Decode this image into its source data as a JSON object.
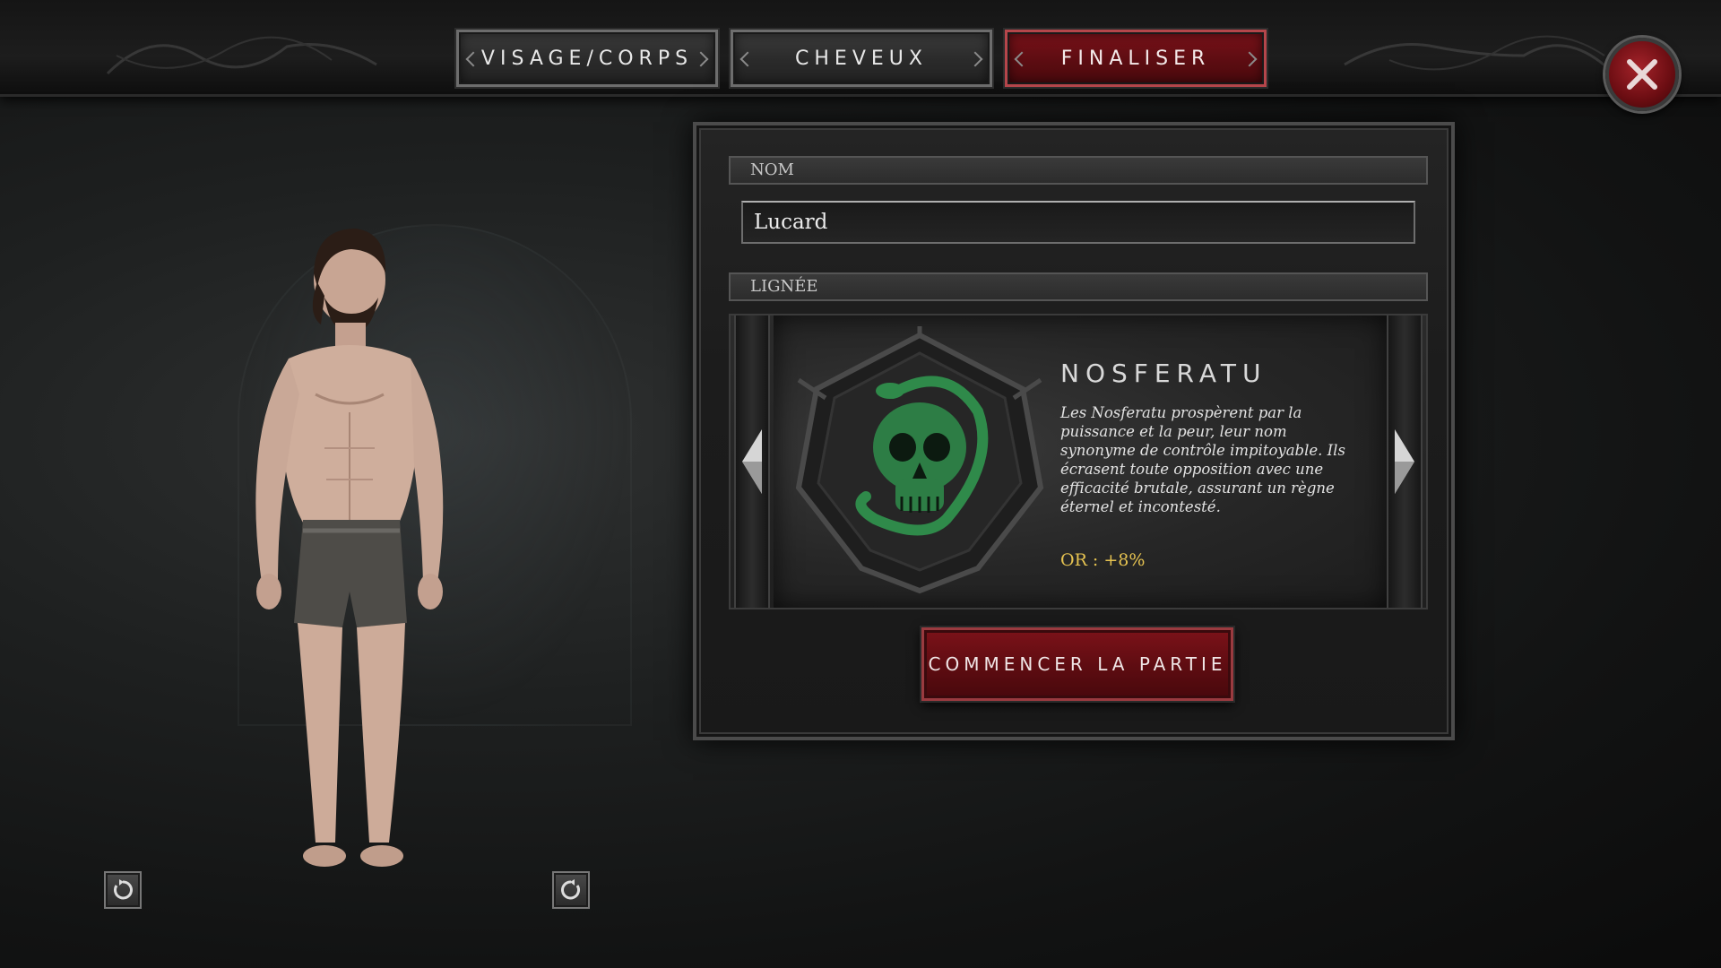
{
  "tabs": [
    {
      "label": "VISAGE/CORPS",
      "active": false
    },
    {
      "label": "CHEVEUX",
      "active": false
    },
    {
      "label": "FINALISER",
      "active": true
    }
  ],
  "panel": {
    "name_header": "NOM",
    "name_value": "Lucard",
    "lineage_header": "LIGNÉE",
    "lineage": {
      "name": "NOSFERATU",
      "description": "Les Nosferatu prospèrent par la puissance et la peur, leur nom synonyme de contrôle impitoyable. Ils écrasent toute opposition avec une efficacité brutale, assurant un règne éternel et incontesté.",
      "bonus": "OR : +8%",
      "emblem_icon": "green-skull-snake-emblem"
    },
    "start_button": "COMMENCER LA PARTIE"
  },
  "icons": {
    "close": "close-x-icon",
    "rotate_left": "rotate-left-icon",
    "rotate_right": "rotate-right-icon",
    "prev": "arrow-left-icon",
    "next": "arrow-right-icon"
  },
  "colors": {
    "accent_red": "#7a1219",
    "bonus_gold": "#e6c351",
    "emblem_green": "#2f8a4a"
  }
}
